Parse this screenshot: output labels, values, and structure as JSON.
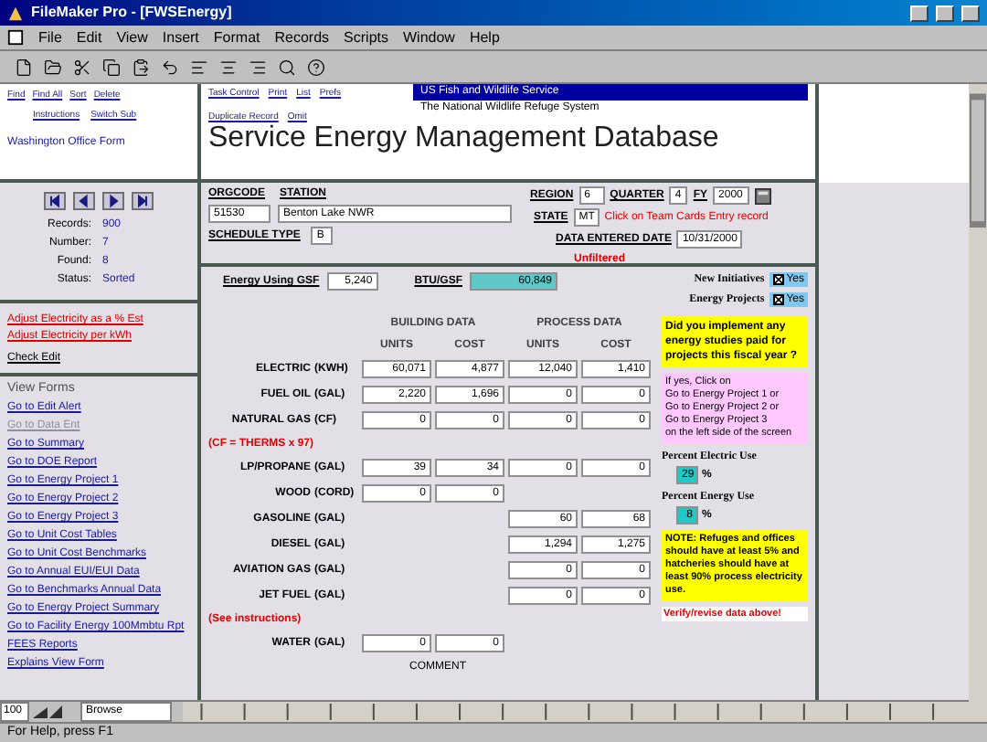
{
  "window": {
    "title": "FileMaker Pro - [FWSEnergy]"
  },
  "menu": [
    "File",
    "Edit",
    "View",
    "Insert",
    "Format",
    "Records",
    "Scripts",
    "Window",
    "Help"
  ],
  "header_links": [
    "Find",
    "Find All",
    "Sort",
    "Delete",
    "Task Control",
    "Print",
    "List",
    "Prefs",
    "Duplicate Record",
    "Omit"
  ],
  "header_links_2": [
    "Instructions",
    "Switch Sub"
  ],
  "form_name": "Washington Office Form",
  "nav": [
    {
      "label": "Records:",
      "value": "900"
    },
    {
      "label": "Number:",
      "value": "7"
    },
    {
      "label": "Found:",
      "value": "8"
    },
    {
      "label": "Status:",
      "value": "Sorted"
    }
  ],
  "adjust_links": [
    "Adjust Electricity as a % Est",
    "Adjust Electricity per kWh"
  ],
  "check_link": "Check Edit",
  "view_forms": {
    "title": "View Forms",
    "items": [
      {
        "label": "Go to Edit Alert",
        "disabled": false
      },
      {
        "label": "Go to Data Ent",
        "disabled": true
      },
      {
        "label": "Go to Summary",
        "disabled": false
      },
      {
        "label": "Go to DOE Report",
        "disabled": false
      },
      {
        "label": "Go to Energy Project 1",
        "disabled": false
      },
      {
        "label": "Go to Energy Project 2",
        "disabled": false
      },
      {
        "label": "Go to Energy Project 3",
        "disabled": false
      },
      {
        "label": "Go to Unit Cost Tables",
        "disabled": false
      },
      {
        "label": "Go to Unit Cost Benchmarks",
        "disabled": false
      },
      {
        "label": "Go to Annual EUI/EUI Data",
        "disabled": false
      },
      {
        "label": "Go to Benchmarks Annual Data",
        "disabled": false
      },
      {
        "label": "Go to Energy Project Summary",
        "disabled": false
      },
      {
        "label": "Go to Facility Energy 100Mmbtu Rpt",
        "disabled": false
      },
      {
        "label": "FEES Reports",
        "disabled": false
      },
      {
        "label": "Explains View Form",
        "disabled": false
      }
    ]
  },
  "agency": {
    "line1": "US Fish and Wildlife Service",
    "line2": "The National Wildlife Refuge System",
    "title": "Service Energy Management Database"
  },
  "station": {
    "orgcode_label": "ORGCODE",
    "orgcode": "51530",
    "station_label": "STATION",
    "station": "Benton Lake NWR",
    "schedule_label": "SCHEDULE TYPE",
    "schedule": "B",
    "region_label": "REGION",
    "region": "6",
    "quarter_label": "QUARTER",
    "quarter": "4",
    "fy_label": "FY",
    "fy": "2000",
    "state_label": "STATE",
    "state": "MT",
    "date_label": "DATA ENTERED DATE",
    "date": "10/31/2000",
    "notice": "Click on Team Cards Entry record",
    "filter": "Unfiltered"
  },
  "form": {
    "gsf_label": "Energy Using GSF",
    "gsf": "5,240",
    "btu_label": "BTU/GSF",
    "btu": "60,849",
    "flags": [
      {
        "label": "New Initiatives",
        "option": "Yes",
        "checked": true
      },
      {
        "label": "Energy Projects",
        "option": "Yes",
        "checked": true
      }
    ],
    "group_headers": [
      "BUILDING DATA",
      "PROCESS DATA"
    ],
    "column_headers": [
      "UNITS",
      "COST",
      "UNITS",
      "COST"
    ],
    "rows": [
      {
        "kind": "fuel",
        "name": "ELECTRIC",
        "unit": "(KWH)",
        "values": [
          "60,071",
          "4,877",
          "12,040",
          "1,410"
        ]
      },
      {
        "kind": "fuel",
        "name": "FUEL OIL",
        "unit": "(GAL)",
        "values": [
          "2,220",
          "1,696",
          "0",
          "0"
        ]
      },
      {
        "kind": "fuel",
        "name": "NATURAL GAS",
        "unit": "(CF)",
        "values": [
          "0",
          "0",
          "0",
          "0"
        ]
      },
      {
        "kind": "note",
        "text": "(CF = THERMS x 97)"
      },
      {
        "kind": "fuel",
        "name": "LP/PROPANE",
        "unit": "(GAL)",
        "values": [
          "39",
          "34",
          "0",
          "0"
        ]
      },
      {
        "kind": "fuel",
        "name": "WOOD",
        "unit": "(CORD)",
        "values": [
          "0",
          "0"
        ]
      },
      {
        "kind": "process",
        "name": "GASOLINE",
        "unit": "(GAL)",
        "values": [
          "60",
          "68"
        ]
      },
      {
        "kind": "process",
        "name": "DIESEL",
        "unit": "(GAL)",
        "values": [
          "1,294",
          "1,275"
        ]
      },
      {
        "kind": "process",
        "name": "AVIATION GAS",
        "unit": "(GAL)",
        "values": [
          "0",
          "0"
        ]
      },
      {
        "kind": "process",
        "name": "JET FUEL",
        "unit": "(GAL)",
        "values": [
          "0",
          "0"
        ]
      },
      {
        "kind": "note",
        "text": "(See instructions)"
      },
      {
        "kind": "fuel",
        "name": "WATER",
        "unit": "(GAL)",
        "values": [
          "0",
          "0"
        ]
      },
      {
        "kind": "caption",
        "text": "COMMENT"
      }
    ],
    "question": "Did you implement any energy studies paid for projects this fiscal year ?",
    "instructions": [
      "If yes, Click on",
      "Go to Energy Project 1 or",
      "Go to Energy Project 2 or",
      "Go to Energy Project 3",
      "on the left side of the screen"
    ],
    "percents": [
      {
        "label": "Percent Electric Use",
        "value": "29",
        "unit": "%"
      },
      {
        "label": "Percent Energy Use",
        "value": "8",
        "unit": "%"
      }
    ],
    "note": "NOTE: Refuges and offices should have at least 5% and hatcheries should have at least 90% process electricity use.",
    "warning": "Verify/revise data above!"
  },
  "mode_bar": {
    "zoom": "100",
    "mode": "Browse"
  },
  "status_bar": "For Help, press F1"
}
